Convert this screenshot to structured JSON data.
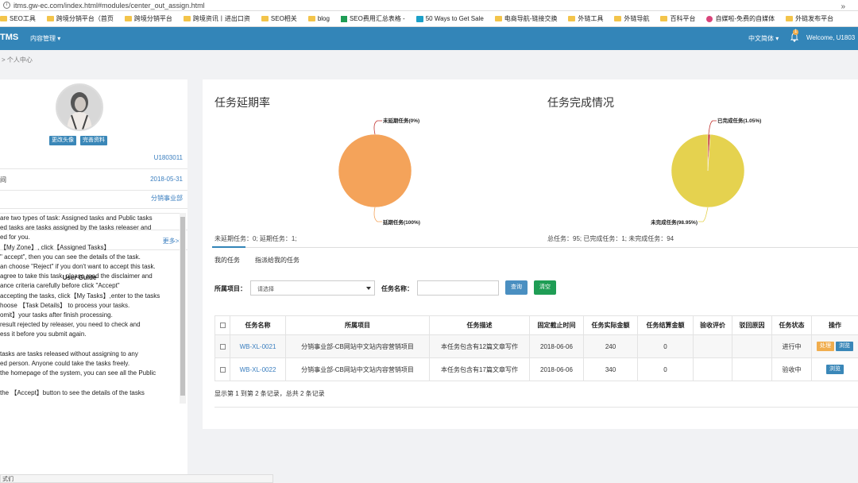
{
  "browser": {
    "url": "itms.gw-ec.com/index.html#modules/center_out_assign.html",
    "bookmarks": [
      {
        "icon": "folder",
        "label": "SEO工具"
      },
      {
        "icon": "folder",
        "label": "跨境分销平台（首页"
      },
      {
        "icon": "folder",
        "label": "跨境分销平台"
      },
      {
        "icon": "folder",
        "label": "跨境资讯丨进出口资"
      },
      {
        "icon": "folder",
        "label": "SEO相关"
      },
      {
        "icon": "folder",
        "label": "blog"
      },
      {
        "icon": "sheet",
        "label": "SEO费用汇总表格 -"
      },
      {
        "icon": "tv",
        "label": "50 Ways to Get Sale"
      },
      {
        "icon": "folder",
        "label": "电商导航-链接交换"
      },
      {
        "icon": "folder",
        "label": "外链工具"
      },
      {
        "icon": "folder",
        "label": "外链导航"
      },
      {
        "icon": "folder",
        "label": "百科平台"
      },
      {
        "icon": "circle",
        "label": "自媒啦-免费的自媒体"
      },
      {
        "icon": "folder",
        "label": "外链发布平台"
      }
    ],
    "more": "»"
  },
  "navbar": {
    "brand": "TMS",
    "menu": "内容管理 ▾",
    "language": "中文简体 ▾",
    "bell_badge": "1",
    "welcome": "Welcome, U1803"
  },
  "breadcrumb": "> 个人中心",
  "profile": {
    "change_avatar": "更改头像",
    "complete_info": "完善资料",
    "rows": [
      {
        "label": "",
        "value": "U1803011"
      },
      {
        "label": "间",
        "value": "2018-05-31"
      },
      {
        "label": "",
        "value": "分销事业部"
      },
      {
        "label": "",
        "value": ""
      },
      {
        "label": "",
        "value": "更多>>"
      }
    ]
  },
  "guide": {
    "title": "User Guide",
    "lines": [
      "are two types of task: Assigned tasks and Public tasks",
      "ed tasks are tasks assigned by the tasks releaser and",
      "ed for you.",
      "【My Zone】, click【Assigned Tasks】",
      "\" accept\", then you can see the details of the task.",
      "an choose \"Reject\" if you don't want to accept this task.",
      "agree to take this task, please read the disclaimer and",
      "ance criteria carefully before click \"Accept\"",
      "accepting the tasks, click【My Tasks】,enter to the tasks",
      "hoose 【Task Details】 to process your tasks.",
      "omit】your tasks after finish processing.",
      "result rejected by releaser, you need to check and",
      "ess it before you submit again.",
      "",
      "tasks are tasks released without assigning to any",
      "ed person. Anyone could take the tasks freely.",
      "the homepage of the system, you can see all the Public",
      "",
      "the 【Accept】button to see the details of the tasks"
    ],
    "status": "式们"
  },
  "delay_chart": {
    "title": "任务延期率",
    "summary": "未延期任务：0; 延期任务：1;",
    "chart_data": {
      "type": "pie",
      "title": "任务延期率",
      "slices": [
        {
          "label": "未延期任务(0%)",
          "value": 0,
          "color": "#c23531"
        },
        {
          "label": "延期任务(100%)",
          "value": 100,
          "color": "#f4a35a"
        }
      ]
    }
  },
  "completion_chart": {
    "title": "任务完成情况",
    "summary": "总任务：95; 已完成任务：1; 未完成任务：94",
    "chart_data": {
      "type": "pie",
      "title": "任务完成情况",
      "slices": [
        {
          "label": "已完成任务(1.05%)",
          "value": 1.05,
          "color": "#c23531"
        },
        {
          "label": "未完成任务(98.95%)",
          "value": 98.95,
          "color": "#e5d24f"
        }
      ]
    }
  },
  "tabs": [
    {
      "label": "我的任务",
      "active": true
    },
    {
      "label": "指派给我的任务",
      "active": false
    }
  ],
  "filters": {
    "project_label": "所属项目：",
    "project_placeholder": "请选择",
    "name_label": "任务名称：",
    "name_value": "",
    "query_button": "查询",
    "clear_button": "清空"
  },
  "table": {
    "headers": [
      "",
      "任务名称",
      "所属项目",
      "任务描述",
      "固定截止时间",
      "任务实际金额",
      "任务结算金额",
      "验收评价",
      "驳回原因",
      "任务状态",
      "操作"
    ],
    "rows": [
      {
        "name": "WB-XL-0021",
        "project": "分销事业部-CB网站中文站内容营销项目",
        "desc": "本任务包含有12篇文章写作",
        "deadline": "2018-06-06",
        "actual": "240",
        "settle": "0",
        "eval": "",
        "reject": "",
        "status": "进行中",
        "actions": [
          "处理",
          "浏览"
        ]
      },
      {
        "name": "WB-XL-0022",
        "project": "分销事业部-CB网站中文站内容营销项目",
        "desc": "本任务包含有17篇文章写作",
        "deadline": "2018-06-06",
        "actual": "340",
        "settle": "0",
        "eval": "",
        "reject": "",
        "status": "验收中",
        "actions": [
          "浏览"
        ]
      }
    ],
    "pager": "显示第 1 到第 2 条记录，总共 2 条记录"
  }
}
